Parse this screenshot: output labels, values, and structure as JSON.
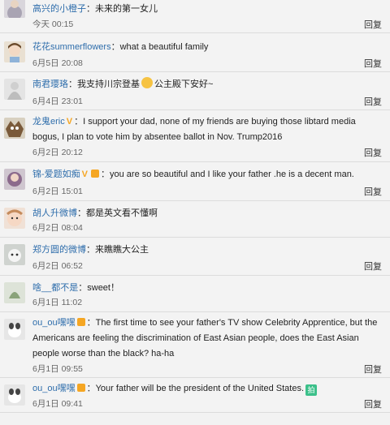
{
  "reply_label": "回复",
  "comments": [
    {
      "name": "高兴的小橙子",
      "text": "未来的第一女儿",
      "time": "今天 00:15"
    },
    {
      "name": "花花summerflowers",
      "text": "what a beautiful family",
      "time": "6月5日 20:08"
    },
    {
      "name": "南君璎珞",
      "text_a": "我支持川宗登基",
      "text_b": "公主殿下安好~",
      "time": "6月4日 23:01"
    },
    {
      "name": "龙鬼eric",
      "text": "I support your dad, none of my friends are buying those libtard media bogus, I plan to vote him by absentee ballot in Nov. Trump2016",
      "time": "6月2日 20:12"
    },
    {
      "name": "锦-爱题如痴",
      "text": "you are so beautiful and I like your father .he is a decent man.",
      "time": "6月2日 15:01"
    },
    {
      "name": "胡人升微博",
      "text": "都是英文看不懂啊",
      "time": "6月2日 08:04"
    },
    {
      "name": "郑方圆的微博",
      "text": "来瞧瞧大公主",
      "time": "6月2日 06:52"
    },
    {
      "name": "啥__都不是",
      "text": "sweet！",
      "time": "6月1日 11:02"
    },
    {
      "name": "ou_ou嘿嘿",
      "text": "The first time to see your father's TV show Celebrity Apprentice, but the Americans are feeling the discrimination of East Asian people, does the East Asian people worse than the black? ha-ha",
      "time": "6月1日 09:55"
    },
    {
      "name": "ou_ou嘿嘿",
      "text": "Your father will be the president of the United States.",
      "emoji": "拍",
      "time": "6月1日 09:41"
    }
  ],
  "colors": {
    "name": "#2e6dab",
    "background": "#f3f3f3",
    "divider": "#dcdcdc"
  }
}
